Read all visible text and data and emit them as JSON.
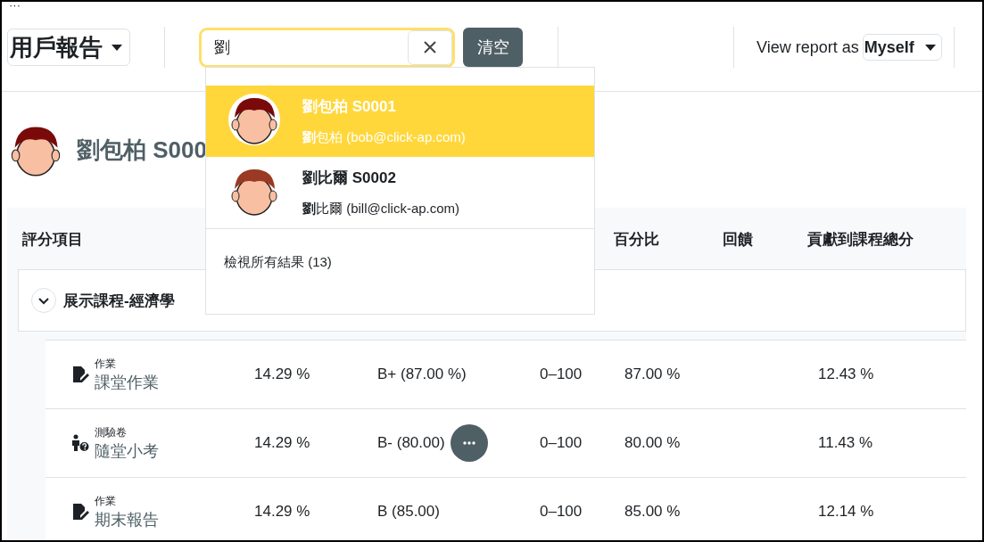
{
  "corner_menu": "···",
  "header": {
    "report_selector": "用戶報告",
    "search": {
      "value": "劉"
    },
    "clear_button": "清空",
    "view_as": {
      "label": "View report as",
      "value": "Myself"
    }
  },
  "search_results": {
    "results": [
      {
        "title": "劉包柏 S0001",
        "detail": "**劉**包柏 (bob@click-ap.com)",
        "selected": true,
        "color": "#7a0a0a"
      },
      {
        "title": "劉比爾 S0002",
        "detail": "**劉**比爾 (bill@click-ap.com)",
        "selected": false,
        "color": "#9a3a24"
      }
    ],
    "view_all": "檢視所有結果 (13)"
  },
  "user": {
    "name": "劉包柏 S000"
  },
  "table": {
    "headers": {
      "item": "評分項目",
      "percentage": "百分比",
      "feedback": "回饋",
      "contribution": "貢獻到課程總分"
    },
    "category": {
      "name": "展示課程-經濟學",
      "expanded": true
    },
    "rows": [
      {
        "kind": "assignment",
        "type": "作業",
        "name": "課堂作業",
        "weight": "14.29 %",
        "grade": "B+ (87.00 %)",
        "range": "0–100",
        "percentage": "87.00 %",
        "contribution": "12.43 %",
        "menu": false
      },
      {
        "kind": "quiz",
        "type": "測驗卷",
        "name": "隨堂小考",
        "weight": "14.29 %",
        "grade": "B- (80.00)",
        "range": "0–100",
        "percentage": "80.00 %",
        "contribution": "11.43 %",
        "menu": true
      },
      {
        "kind": "assignment",
        "type": "作業",
        "name": "期末報告",
        "weight": "14.29 %",
        "grade": "B (85.00)",
        "range": "0–100",
        "percentage": "85.00 %",
        "contribution": "12.14 %",
        "menu": false
      }
    ]
  }
}
